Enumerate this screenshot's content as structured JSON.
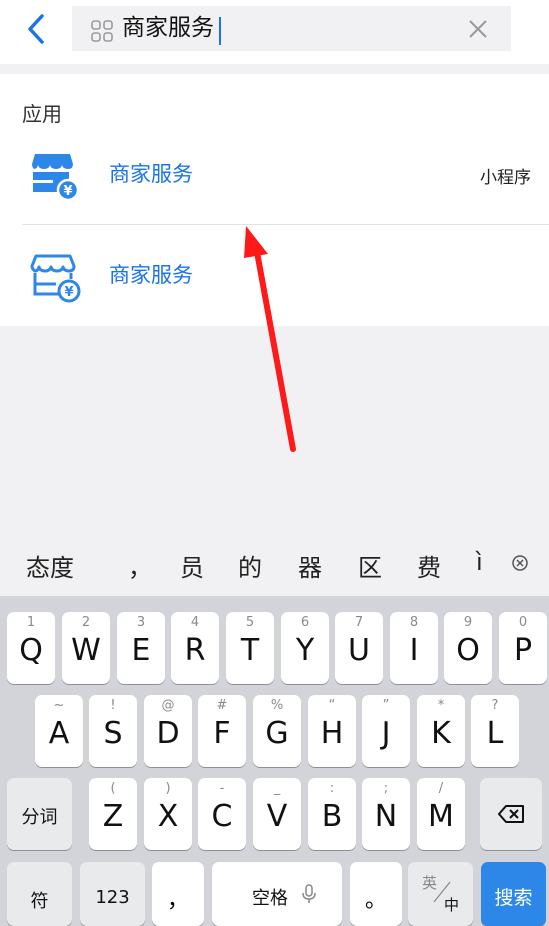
{
  "search": {
    "query": "商家服务"
  },
  "results": {
    "section_title": "应用",
    "items": [
      {
        "name": "商家服务",
        "tag": "小程序",
        "icon": "merchant-store-filled-icon"
      },
      {
        "name": "商家服务",
        "tag": "",
        "icon": "merchant-store-outline-icon"
      }
    ]
  },
  "annotation": {
    "color": "#ff1a1a",
    "shape": "red-arrow"
  },
  "candidates": [
    "态度",
    "，",
    "员",
    "的",
    "器",
    "区",
    "费",
    "ì"
  ],
  "keyboard": {
    "row1": [
      {
        "main": "Q",
        "sub": "1"
      },
      {
        "main": "W",
        "sub": "2"
      },
      {
        "main": "E",
        "sub": "3"
      },
      {
        "main": "R",
        "sub": "4"
      },
      {
        "main": "T",
        "sub": "5"
      },
      {
        "main": "Y",
        "sub": "6"
      },
      {
        "main": "U",
        "sub": "7"
      },
      {
        "main": "I",
        "sub": "8"
      },
      {
        "main": "O",
        "sub": "9"
      },
      {
        "main": "P",
        "sub": "0"
      }
    ],
    "row2": [
      {
        "main": "A",
        "sub": "~"
      },
      {
        "main": "S",
        "sub": "!"
      },
      {
        "main": "D",
        "sub": "@"
      },
      {
        "main": "F",
        "sub": "#"
      },
      {
        "main": "G",
        "sub": "%"
      },
      {
        "main": "H",
        "sub": "“"
      },
      {
        "main": "J",
        "sub": "”"
      },
      {
        "main": "K",
        "sub": "*"
      },
      {
        "main": "L",
        "sub": "?"
      }
    ],
    "row3": [
      {
        "main": "Z",
        "sub": "("
      },
      {
        "main": "X",
        "sub": ")"
      },
      {
        "main": "C",
        "sub": "-"
      },
      {
        "main": "V",
        "sub": "_"
      },
      {
        "main": "B",
        "sub": ":"
      },
      {
        "main": "N",
        "sub": ";"
      },
      {
        "main": "M",
        "sub": "/"
      }
    ],
    "fenci": "分词",
    "fu": "符",
    "num": "123",
    "comma": "，",
    "space": "空格",
    "period": "。",
    "lang_top": "英",
    "lang_bottom": "中",
    "search": "搜索",
    "accent": "#2d87e8"
  }
}
